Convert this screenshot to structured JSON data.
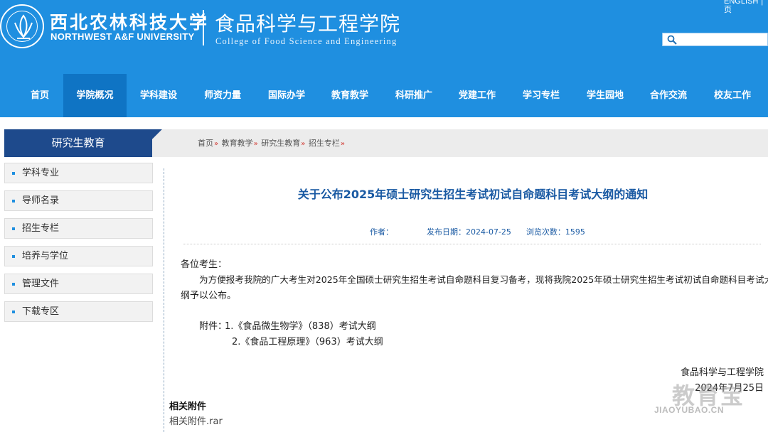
{
  "header": {
    "university_cn": "西北农林科技大学",
    "university_en": "NORTHWEST A&F UNIVERSITY",
    "college_cn": "食品科学与工程学院",
    "college_en": "College of Food Science and Engineering",
    "lang_link_line1": "ENGLISH",
    "lang_link_pipe": "|",
    "lang_link_line2": "页",
    "search_placeholder": ""
  },
  "nav": {
    "items": [
      "首页",
      "学院概况",
      "学科建设",
      "师资力量",
      "国际办学",
      "教育教学",
      "科研推广",
      "党建工作",
      "学习专栏",
      "学生园地",
      "合作交流",
      "校友工作"
    ],
    "active_index": 1
  },
  "sidebar": {
    "title": "研究生教育",
    "items": [
      "学科专业",
      "导师名录",
      "招生专栏",
      "培养与学位",
      "管理文件",
      "下载专区"
    ]
  },
  "breadcrumb": {
    "items": [
      "首页",
      "教育教学",
      "研究生教育",
      "招生专栏"
    ],
    "separator": "»"
  },
  "article": {
    "title": "关于公布2025年硕士研究生招生考试初试自命题科目考试大纲的通知",
    "meta": {
      "author_label": "作者：",
      "date_label": "发布日期：2024-07-25",
      "views_label": "浏览次数：1595"
    },
    "greeting": "各位考生：",
    "paragraph_line1": "为方便报考我院的广大考生对2025年全国硕士研究生招生考试自命题科目复习备考，现将我院2025年硕士研究生招生考试初试自命题科目考试大",
    "paragraph_line2": "纲予以公布。",
    "attachments_label": "附件：",
    "attachment_1": "1.《食品微生物学》（838）考试大纲",
    "attachment_2": "2.《食品工程原理》（963）考试大纲",
    "signature": "食品科学与工程学院",
    "sign_date": "2024年7月25日"
  },
  "related": {
    "heading": "相关附件",
    "file": "相关附件.rar"
  },
  "watermark": {
    "cn": "教育宝",
    "en": "JIAOYUBAO.CN"
  },
  "colors": {
    "brand_blue": "#1f8fe0",
    "nav_active": "#0f74c4",
    "sidebar_title_bg": "#1e4a8c",
    "title_blue": "#1a5aa3",
    "breadcrumb_separator": "#d0342c"
  },
  "icons": [
    "university-emblem-icon",
    "search-icon"
  ]
}
